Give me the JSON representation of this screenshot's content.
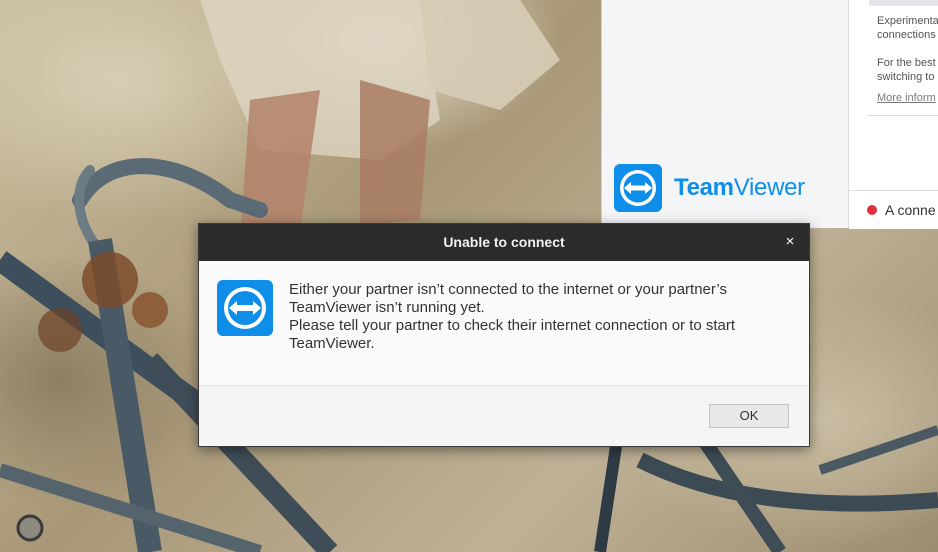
{
  "teamviewer_window": {
    "logo_text_bold": "Team",
    "logo_text_light": "Viewer",
    "experimental_line1": "Experimenta",
    "experimental_line2": "connections",
    "best_line1": "For the best",
    "best_line2": "switching to",
    "more_info_link": "More inform",
    "status_text": "A conne",
    "status_color": "#e0303a",
    "brand_color": "#0e8ee9"
  },
  "dialog": {
    "title": "Unable to connect",
    "close_symbol": "×",
    "icon": "teamviewer-logo-icon",
    "message_line1": "Either your partner isn’t connected to the internet or your partner’s",
    "message_line2": "TeamViewer isn’t running yet.",
    "message_line3": "Please tell your partner to check their internet connection or to start",
    "message_line4": "TeamViewer.",
    "ok_label": "OK"
  }
}
